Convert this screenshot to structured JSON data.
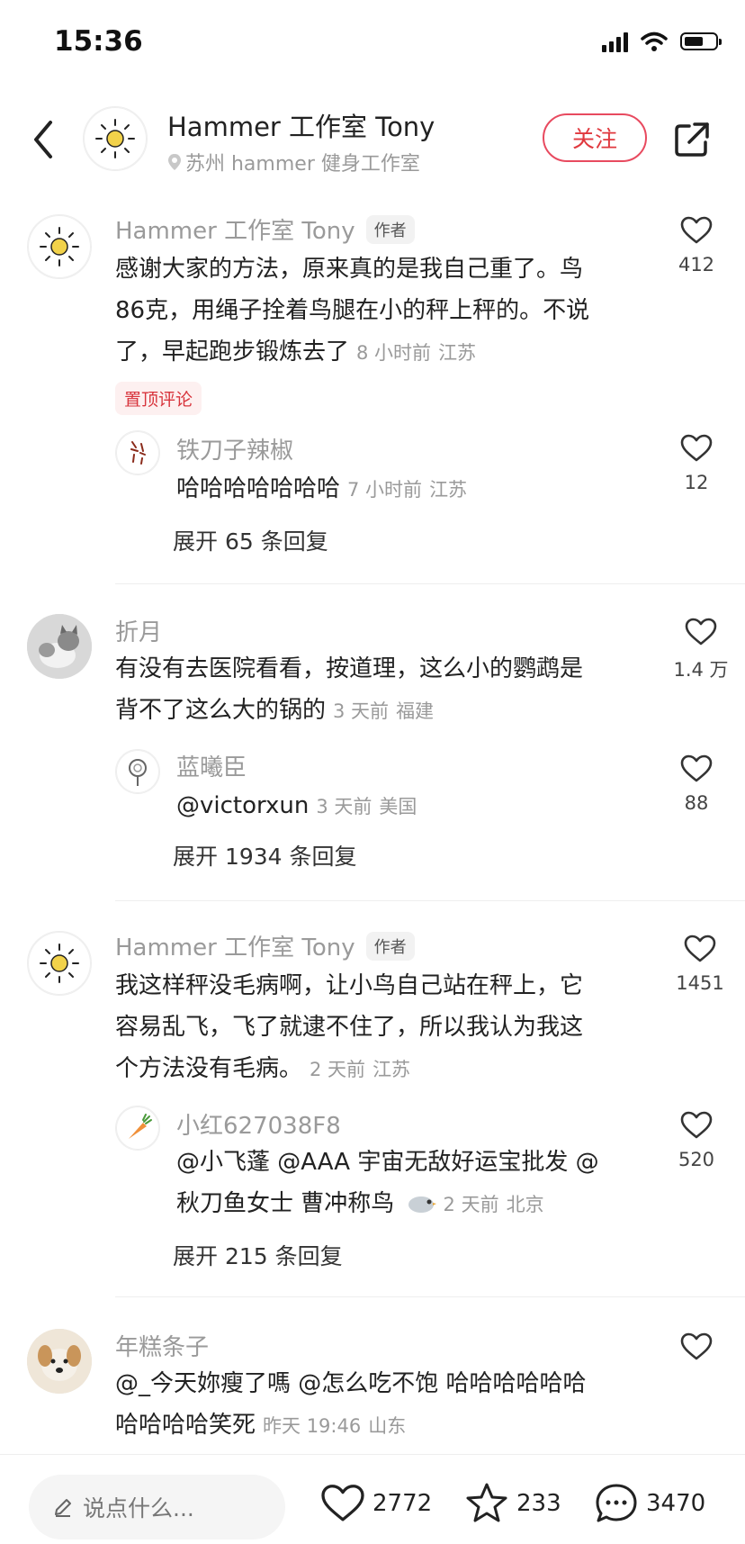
{
  "status": {
    "time": "15:36"
  },
  "header": {
    "name": "Hammer 工作室 Tony",
    "location": "苏州 hammer 健身工作室",
    "follow_label": "关注"
  },
  "comments": [
    {
      "name": "Hammer 工作室 Tony",
      "badge": "作者",
      "lines": [
        "感谢大家的方法，原来真的是我自己重了。鸟",
        "86克，用绳子拴着鸟腿在小的秤上秤的。不说",
        "了，早起跑步锻炼去了"
      ],
      "time": "8 小时前",
      "region": "江苏",
      "likes": "412",
      "pin_label": "置顶评论",
      "reply": {
        "name": "铁刀子辣椒",
        "text": "哈哈哈哈哈哈哈",
        "time": "7 小时前",
        "region": "江苏",
        "likes": "12"
      },
      "expand": "展开 65 条回复"
    },
    {
      "name": "折月",
      "lines": [
        "有没有去医院看看，按道理，这么小的鹦鹉是",
        "背不了这么大的锅的"
      ],
      "time": "3 天前",
      "region": "福建",
      "likes": "1.4 万",
      "reply": {
        "name": "蓝曦臣",
        "text": "@victorxun",
        "time": "3 天前",
        "region": "美国",
        "likes": "88"
      },
      "expand": "展开 1934 条回复"
    },
    {
      "name": "Hammer 工作室 Tony",
      "badge": "作者",
      "lines": [
        "我这样秤没毛病啊，让小鸟自己站在秤上，它",
        "容易乱飞，飞了就逮不住了，所以我认为我这",
        "个方法没有毛病。"
      ],
      "time": "2 天前",
      "region": "江苏",
      "likes": "1451",
      "reply": {
        "name": "小红627038F8",
        "lines": [
          "@小飞蓬 @AAA 宇宙无敌好运宝批发 @",
          "秋刀鱼女士 曹冲称鸟"
        ],
        "time": "2 天前",
        "region": "北京",
        "likes": "520"
      },
      "expand": "展开 215 条回复"
    },
    {
      "name": "年糕条子",
      "lines": [
        "@_今天妳瘦了嗎 @怎么吃不饱 哈哈哈哈哈哈",
        "哈哈哈哈笑死"
      ],
      "time": "昨天 19:46",
      "region": "山东"
    }
  ],
  "bottom": {
    "placeholder": "说点什么...",
    "likes": "2772",
    "favorites": "233",
    "comments": "3470"
  },
  "colors": {
    "accent": "#e0383e",
    "gray_text": "#9a9a9a"
  }
}
